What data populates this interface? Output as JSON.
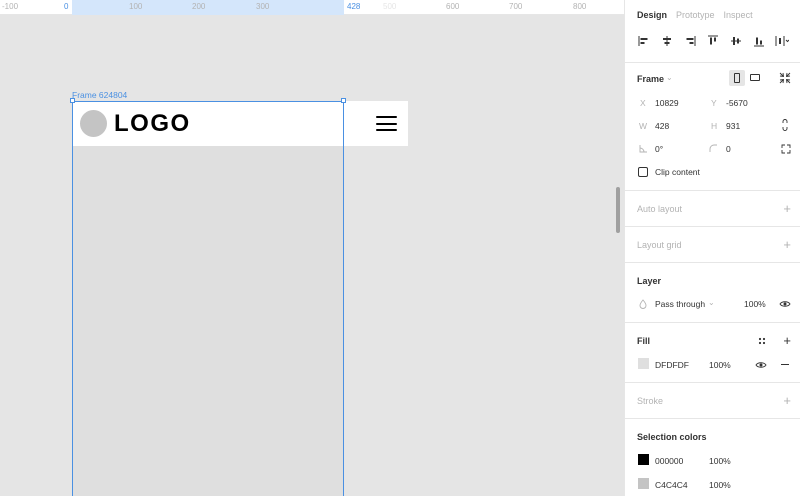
{
  "ruler": {
    "ticks": [
      "-100",
      "0",
      "100",
      "200",
      "300",
      "428",
      "500",
      "600",
      "700",
      "800"
    ]
  },
  "canvas": {
    "frame_label": "Frame 624804",
    "logo_text": "LOGO"
  },
  "panel": {
    "tabs": [
      "Design",
      "Prototype",
      "Inspect"
    ],
    "frame": {
      "title": "Frame",
      "x_label": "X",
      "x_value": "10829",
      "y_label": "Y",
      "y_value": "-5670",
      "w_label": "W",
      "w_value": "428",
      "h_label": "H",
      "h_value": "931",
      "rotation": "0°",
      "radius": "0",
      "clip_content": "Clip content"
    },
    "auto_layout": "Auto layout",
    "layout_grid": "Layout grid",
    "layer": {
      "title": "Layer",
      "blend": "Pass through",
      "opacity": "100%"
    },
    "fill": {
      "title": "Fill",
      "hex": "DFDFDF",
      "opacity": "100%",
      "color": "#dfdfdf"
    },
    "stroke": "Stroke",
    "selection_colors": {
      "title": "Selection colors",
      "items": [
        {
          "hex": "000000",
          "opacity": "100%",
          "color": "#000000"
        },
        {
          "hex": "C4C4C4",
          "opacity": "100%",
          "color": "#c4c4c4"
        }
      ]
    }
  }
}
